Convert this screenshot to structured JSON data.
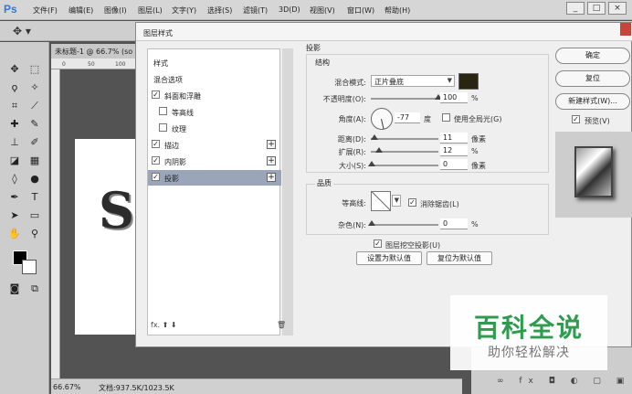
{
  "app": {
    "logo": "Ps",
    "menu": [
      "文件(F)",
      "编辑(E)",
      "图像(I)",
      "图层(L)",
      "文字(Y)",
      "选择(S)",
      "滤镜(T)",
      "3D(D)",
      "视图(V)",
      "窗口(W)",
      "帮助(H)"
    ],
    "window_controls": [
      "_",
      "□",
      "×"
    ]
  },
  "document": {
    "tab_title": "未标题-1 @ 66.7% (so",
    "ruler_marks": [
      "0",
      "50",
      "100"
    ],
    "canvas_letter": "S",
    "zoom": "66.67%",
    "doc_info": "文档:937.5K/1023.5K"
  },
  "dialog": {
    "title": "图层样式",
    "style_list": [
      {
        "label": "样式",
        "checkbox": null,
        "checked": false,
        "plus": false,
        "selected": false,
        "indent": false
      },
      {
        "label": "混合选项",
        "checkbox": null,
        "checked": false,
        "plus": false,
        "selected": false,
        "indent": false
      },
      {
        "label": "斜面和浮雕",
        "checkbox": true,
        "checked": true,
        "plus": false,
        "selected": false,
        "indent": false
      },
      {
        "label": "等高线",
        "checkbox": true,
        "checked": false,
        "plus": false,
        "selected": false,
        "indent": true
      },
      {
        "label": "纹理",
        "checkbox": true,
        "checked": false,
        "plus": false,
        "selected": false,
        "indent": true
      },
      {
        "label": "描边",
        "checkbox": true,
        "checked": true,
        "plus": true,
        "selected": false,
        "indent": false
      },
      {
        "label": "内阴影",
        "checkbox": true,
        "checked": true,
        "plus": true,
        "selected": false,
        "indent": false
      },
      {
        "label": "投影",
        "checkbox": true,
        "checked": true,
        "plus": true,
        "selected": true,
        "indent": false
      }
    ],
    "list_footer": "fx. ⬆ ⬇",
    "drop_shadow": {
      "group_title": "投影",
      "structure_title": "结构",
      "blend_mode_label": "混合模式:",
      "blend_mode_value": "正片叠底",
      "shadow_color": "#2a2510",
      "opacity_label": "不透明度(O):",
      "opacity_value": "100",
      "opacity_unit": "%",
      "angle_label": "角度(A):",
      "angle_value": "-77",
      "angle_unit": "度",
      "global_light_label": "使用全局光(G)",
      "global_light_checked": false,
      "distance_label": "距离(D):",
      "distance_value": "11",
      "distance_unit": "像素",
      "spread_label": "扩展(R):",
      "spread_value": "12",
      "spread_unit": "%",
      "size_label": "大小(S):",
      "size_value": "0",
      "size_unit": "像素",
      "quality_title": "品质",
      "contour_label": "等高线:",
      "anti_alias_label": "消除锯齿(L)",
      "anti_alias_checked": true,
      "noise_label": "杂色(N):",
      "noise_value": "0",
      "noise_unit": "%",
      "knockout_label": "图层挖空投影(U)",
      "knockout_checked": true,
      "set_default_label": "设置为默认值",
      "reset_default_label": "复位为默认值"
    },
    "buttons": {
      "ok": "确定",
      "reset": "复位",
      "new_style": "新建样式(W)...",
      "preview_label": "预览(V)",
      "preview_checked": true
    }
  },
  "layers_footer_icons": "∞ fx ◘ ◐ ▢ ▣ ⊞",
  "watermark": {
    "main": "百科全说",
    "sub": "助你轻松解决"
  }
}
